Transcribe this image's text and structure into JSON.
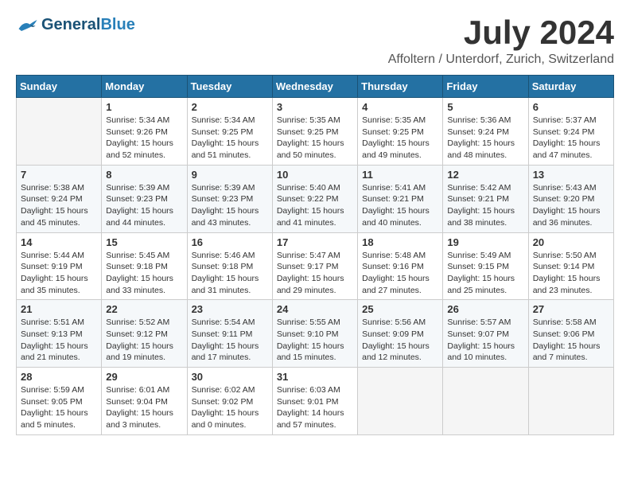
{
  "header": {
    "logo_general": "General",
    "logo_blue": "Blue",
    "month_title": "July 2024",
    "location": "Affoltern / Unterdorf, Zurich, Switzerland"
  },
  "calendar": {
    "days_of_week": [
      "Sunday",
      "Monday",
      "Tuesday",
      "Wednesday",
      "Thursday",
      "Friday",
      "Saturday"
    ],
    "weeks": [
      [
        {
          "day": "",
          "info": ""
        },
        {
          "day": "1",
          "info": "Sunrise: 5:34 AM\nSunset: 9:26 PM\nDaylight: 15 hours\nand 52 minutes."
        },
        {
          "day": "2",
          "info": "Sunrise: 5:34 AM\nSunset: 9:25 PM\nDaylight: 15 hours\nand 51 minutes."
        },
        {
          "day": "3",
          "info": "Sunrise: 5:35 AM\nSunset: 9:25 PM\nDaylight: 15 hours\nand 50 minutes."
        },
        {
          "day": "4",
          "info": "Sunrise: 5:35 AM\nSunset: 9:25 PM\nDaylight: 15 hours\nand 49 minutes."
        },
        {
          "day": "5",
          "info": "Sunrise: 5:36 AM\nSunset: 9:24 PM\nDaylight: 15 hours\nand 48 minutes."
        },
        {
          "day": "6",
          "info": "Sunrise: 5:37 AM\nSunset: 9:24 PM\nDaylight: 15 hours\nand 47 minutes."
        }
      ],
      [
        {
          "day": "7",
          "info": "Sunrise: 5:38 AM\nSunset: 9:24 PM\nDaylight: 15 hours\nand 45 minutes."
        },
        {
          "day": "8",
          "info": "Sunrise: 5:39 AM\nSunset: 9:23 PM\nDaylight: 15 hours\nand 44 minutes."
        },
        {
          "day": "9",
          "info": "Sunrise: 5:39 AM\nSunset: 9:23 PM\nDaylight: 15 hours\nand 43 minutes."
        },
        {
          "day": "10",
          "info": "Sunrise: 5:40 AM\nSunset: 9:22 PM\nDaylight: 15 hours\nand 41 minutes."
        },
        {
          "day": "11",
          "info": "Sunrise: 5:41 AM\nSunset: 9:21 PM\nDaylight: 15 hours\nand 40 minutes."
        },
        {
          "day": "12",
          "info": "Sunrise: 5:42 AM\nSunset: 9:21 PM\nDaylight: 15 hours\nand 38 minutes."
        },
        {
          "day": "13",
          "info": "Sunrise: 5:43 AM\nSunset: 9:20 PM\nDaylight: 15 hours\nand 36 minutes."
        }
      ],
      [
        {
          "day": "14",
          "info": "Sunrise: 5:44 AM\nSunset: 9:19 PM\nDaylight: 15 hours\nand 35 minutes."
        },
        {
          "day": "15",
          "info": "Sunrise: 5:45 AM\nSunset: 9:18 PM\nDaylight: 15 hours\nand 33 minutes."
        },
        {
          "day": "16",
          "info": "Sunrise: 5:46 AM\nSunset: 9:18 PM\nDaylight: 15 hours\nand 31 minutes."
        },
        {
          "day": "17",
          "info": "Sunrise: 5:47 AM\nSunset: 9:17 PM\nDaylight: 15 hours\nand 29 minutes."
        },
        {
          "day": "18",
          "info": "Sunrise: 5:48 AM\nSunset: 9:16 PM\nDaylight: 15 hours\nand 27 minutes."
        },
        {
          "day": "19",
          "info": "Sunrise: 5:49 AM\nSunset: 9:15 PM\nDaylight: 15 hours\nand 25 minutes."
        },
        {
          "day": "20",
          "info": "Sunrise: 5:50 AM\nSunset: 9:14 PM\nDaylight: 15 hours\nand 23 minutes."
        }
      ],
      [
        {
          "day": "21",
          "info": "Sunrise: 5:51 AM\nSunset: 9:13 PM\nDaylight: 15 hours\nand 21 minutes."
        },
        {
          "day": "22",
          "info": "Sunrise: 5:52 AM\nSunset: 9:12 PM\nDaylight: 15 hours\nand 19 minutes."
        },
        {
          "day": "23",
          "info": "Sunrise: 5:54 AM\nSunset: 9:11 PM\nDaylight: 15 hours\nand 17 minutes."
        },
        {
          "day": "24",
          "info": "Sunrise: 5:55 AM\nSunset: 9:10 PM\nDaylight: 15 hours\nand 15 minutes."
        },
        {
          "day": "25",
          "info": "Sunrise: 5:56 AM\nSunset: 9:09 PM\nDaylight: 15 hours\nand 12 minutes."
        },
        {
          "day": "26",
          "info": "Sunrise: 5:57 AM\nSunset: 9:07 PM\nDaylight: 15 hours\nand 10 minutes."
        },
        {
          "day": "27",
          "info": "Sunrise: 5:58 AM\nSunset: 9:06 PM\nDaylight: 15 hours\nand 7 minutes."
        }
      ],
      [
        {
          "day": "28",
          "info": "Sunrise: 5:59 AM\nSunset: 9:05 PM\nDaylight: 15 hours\nand 5 minutes."
        },
        {
          "day": "29",
          "info": "Sunrise: 6:01 AM\nSunset: 9:04 PM\nDaylight: 15 hours\nand 3 minutes."
        },
        {
          "day": "30",
          "info": "Sunrise: 6:02 AM\nSunset: 9:02 PM\nDaylight: 15 hours\nand 0 minutes."
        },
        {
          "day": "31",
          "info": "Sunrise: 6:03 AM\nSunset: 9:01 PM\nDaylight: 14 hours\nand 57 minutes."
        },
        {
          "day": "",
          "info": ""
        },
        {
          "day": "",
          "info": ""
        },
        {
          "day": "",
          "info": ""
        }
      ]
    ]
  }
}
